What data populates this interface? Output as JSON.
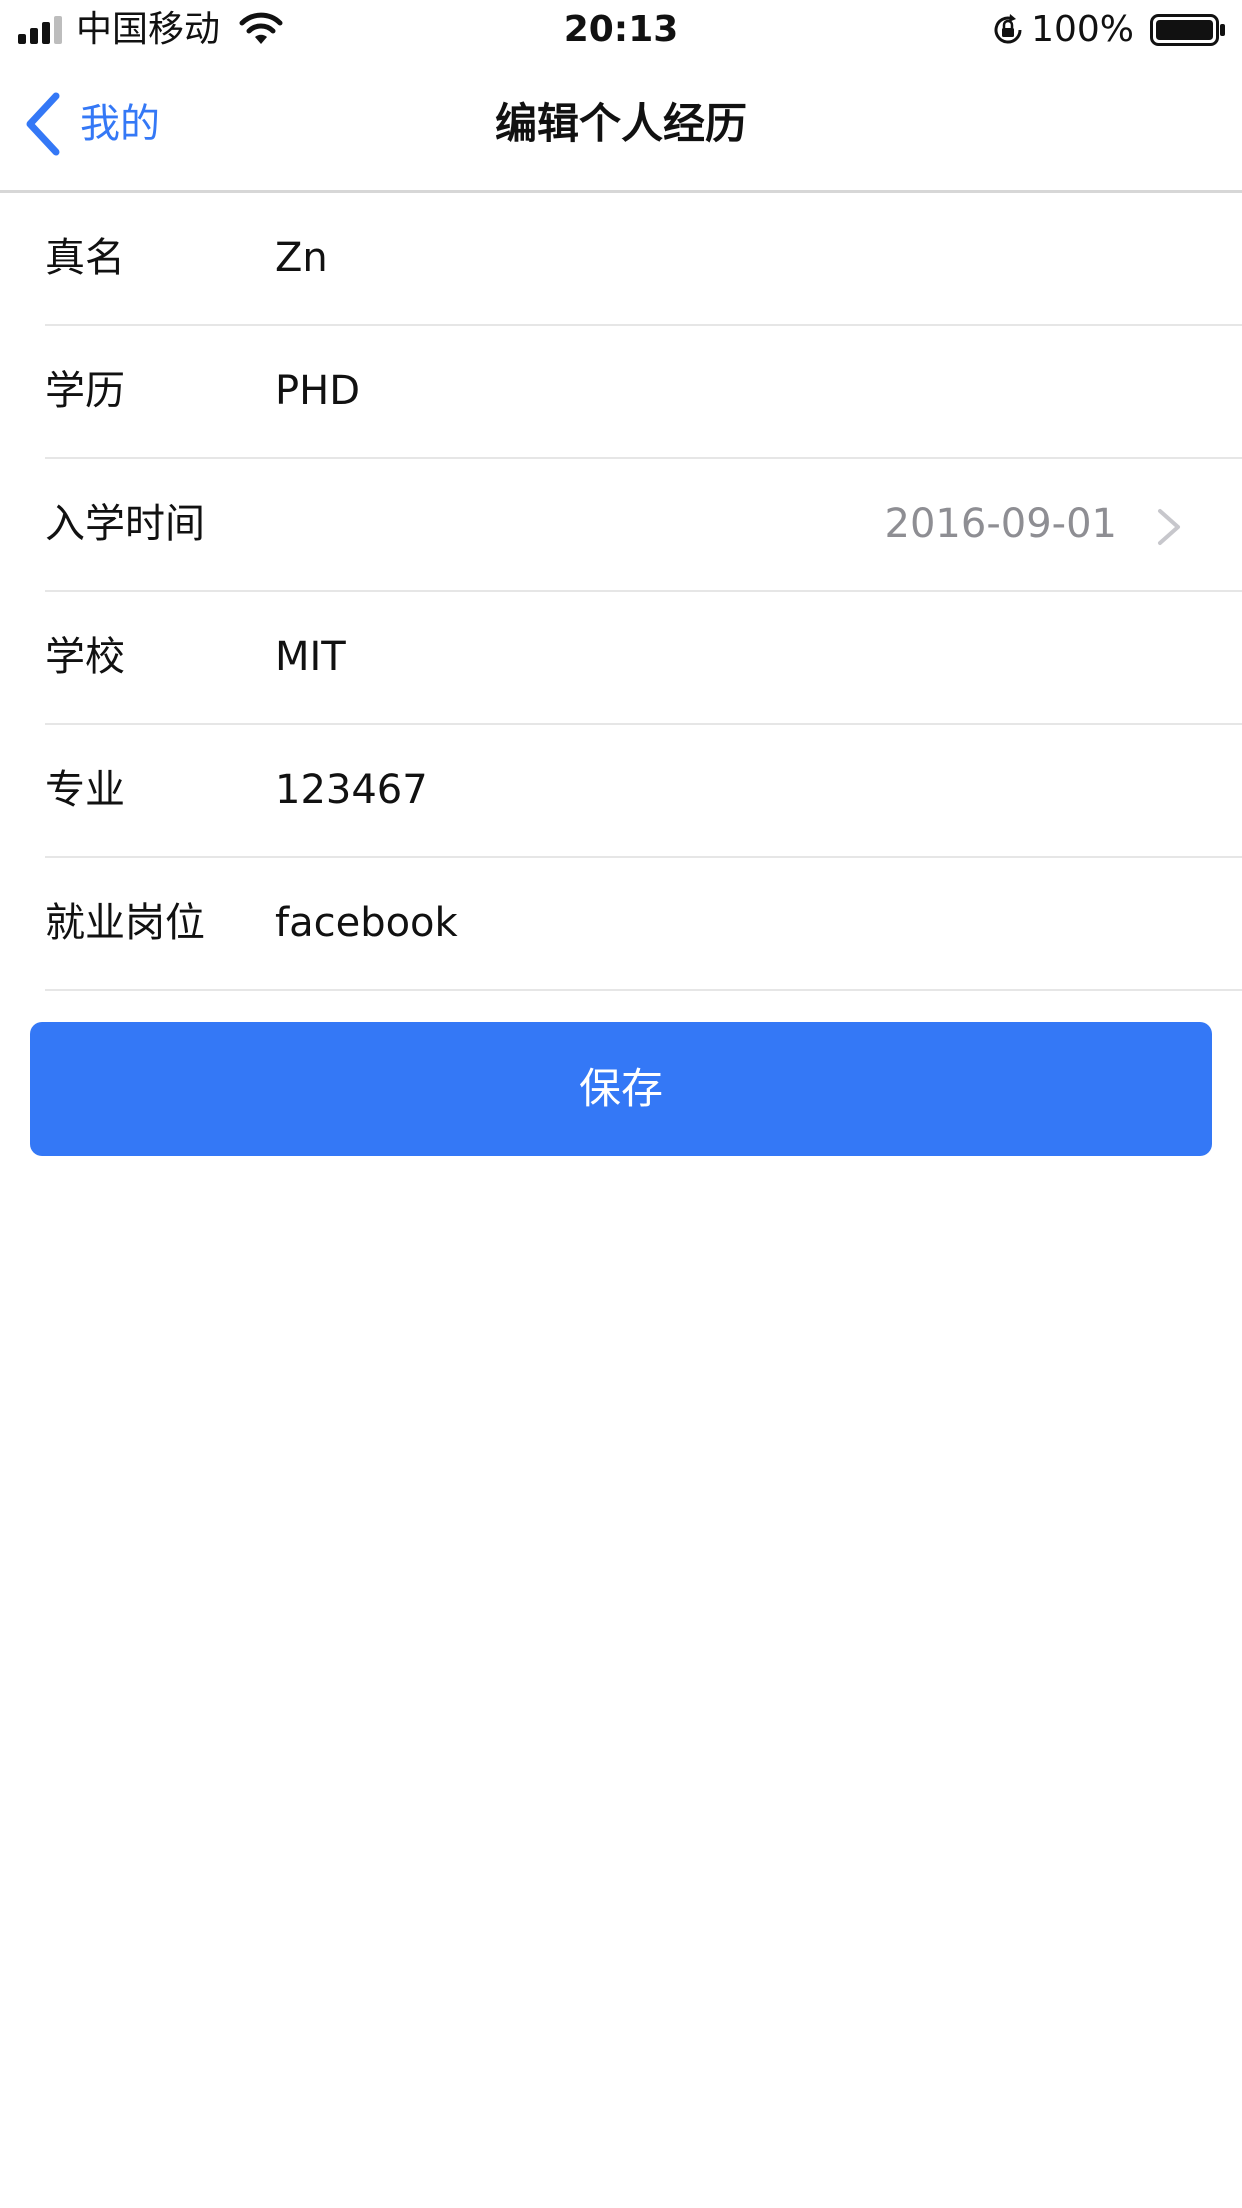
{
  "status_bar": {
    "carrier": "中国移动",
    "time": "20:13",
    "battery_percent": "100%",
    "icons": [
      "signal-icon",
      "wifi-icon",
      "orientation-lock-icon",
      "battery-icon"
    ]
  },
  "nav": {
    "back_label": "我的",
    "title": "编辑个人经历"
  },
  "form": {
    "rows": [
      {
        "label": "真名",
        "value": "Zn"
      },
      {
        "label": "学历",
        "value": "PHD"
      },
      {
        "label": "入学时间",
        "value": "2016-09-01"
      },
      {
        "label": "学校",
        "value": "MIT"
      },
      {
        "label": "专业",
        "value": "123467"
      },
      {
        "label": "就业岗位",
        "value": "facebook"
      }
    ]
  },
  "save_label": "保存",
  "colors": {
    "accent": "#3478f6",
    "separator": "#e6e6e6",
    "secondary_text": "#8e8e93"
  }
}
